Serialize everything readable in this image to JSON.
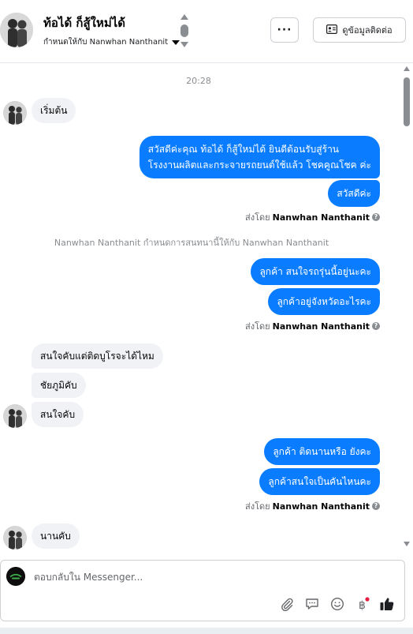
{
  "header": {
    "contact_name": "ท้อได้ ก็สู้ใหม่ได้",
    "assigned_label": "กำหนดให้กับ Nanwhan Nanthanit",
    "more_label": "···",
    "view_info_label": "ดูข้อมูลติดต่อ"
  },
  "chat": {
    "timestamp": "20:28",
    "msg_start": "เริ่มต้น",
    "out_greeting_line1": "สวัสดีค่ะคุณ ท้อได้ ก็สู้ใหม่ได้ ยินดีต้อนรับสู่ร้าน",
    "out_greeting_line2": "โรงงานผลิตและกระจายรถยนต์ใช้แล้ว โชคคูณโชค ค่ะ",
    "out_hello": "สวัสดีค่ะ",
    "sent_by_prefix": "ส่งโดย",
    "agent_name": "Nanwhan Nanthanit",
    "system_note": "Nanwhan Nanthanit กำหนดการสนทนานี้ให้กับ Nanwhan Nanthanit",
    "out_q1": "ลูกค้า สนใจรถรุ่นนี้อยู่นะคะ",
    "out_q2": "ลูกค้าอยู่จังหวัดอะไรคะ",
    "in_r1": "สนใจคับแต่ติดบูโรจะได้ไหม",
    "in_r2": "ชัยภูมิคับ",
    "in_r3": "สนใจคับ",
    "out_q3": "ลูกค้า ติดนานหรือ ยังคะ",
    "out_q4": "ลูกค้าสนใจเป็นคันไหนคะ",
    "in_r4": "นานคับ"
  },
  "composer": {
    "placeholder": "ตอบกลับใน Messenger..."
  },
  "icons": {
    "attach": "paperclip-icon",
    "saved_replies": "chat-bubble-icon",
    "emoji": "smiley-icon",
    "payment": "baht-icon",
    "like": "thumbs-up-icon"
  },
  "colors": {
    "outgoing_bubble": "#0a7cff",
    "incoming_bubble": "#f0f2f5",
    "like_icon": "#1c1e21",
    "notification_dot": "#e41e3f"
  }
}
